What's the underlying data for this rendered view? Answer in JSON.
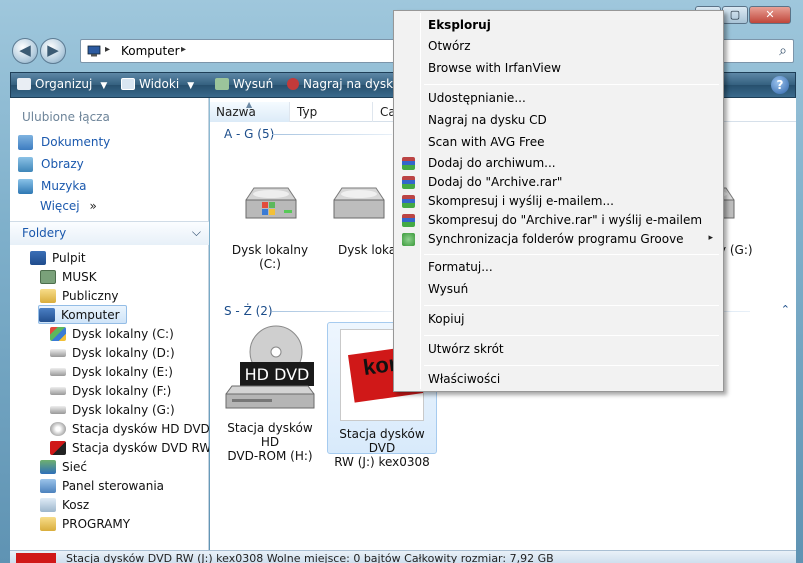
{
  "window": {
    "buttons": {
      "minimize": "",
      "maximize": "▢",
      "close": "✕"
    }
  },
  "address_bar": {
    "crumb": "Komputer",
    "sep1": "▸",
    "sep2": "▸"
  },
  "toolbar": {
    "organize": "Organizuj",
    "views": "Widoki",
    "eject": "Wysuń",
    "burn": "Nagraj na dysku",
    "help": "?"
  },
  "sidebar": {
    "favorites_title": "Ulubione łącza",
    "favorites": [
      {
        "label": "Dokumenty"
      },
      {
        "label": "Obrazy"
      },
      {
        "label": "Muzyka"
      }
    ],
    "more": "Więcej",
    "more_arrows": "»",
    "folders_title": "Foldery",
    "tree": [
      {
        "label": "Pulpit"
      },
      {
        "label": "MUSK"
      },
      {
        "label": "Publiczny"
      },
      {
        "label": "Komputer"
      },
      {
        "label": "Dysk lokalny (C:)"
      },
      {
        "label": "Dysk lokalny (D:)"
      },
      {
        "label": "Dysk lokalny (E:)"
      },
      {
        "label": "Dysk lokalny (F:)"
      },
      {
        "label": "Dysk lokalny (G:)"
      },
      {
        "label": "Stacja dysków HD DVD-R("
      },
      {
        "label": "Stacja dysków DVD RW (J:"
      },
      {
        "label": "Sieć"
      },
      {
        "label": "Panel sterowania"
      },
      {
        "label": "Kosz"
      },
      {
        "label": "PROGRAMY"
      }
    ]
  },
  "columns": {
    "name": "Nazwa",
    "type": "Typ",
    "total": "Cał"
  },
  "groups": {
    "a_g": "A - G (5)",
    "s_z": "S - Ż (2)"
  },
  "drives": {
    "c": "Dysk lokalny (C:)",
    "d": "Dysk lokal",
    "g": "lny (G:)",
    "hd_line1": "Stacja dysków HD",
    "hd_line2": "DVD-ROM (H:)",
    "dvd_line1": "Stacja dysków DVD",
    "dvd_line2": "RW (J:) kex0308",
    "hd_badge": "HD DVD",
    "dvd_badge": "kom"
  },
  "context_menu": {
    "items": [
      {
        "label": "Eksploruj"
      },
      {
        "label": "Otwórz"
      },
      {
        "label": "Browse with IrfanView"
      },
      {
        "label": "Udostępnianie..."
      },
      {
        "label": "Nagraj na dysku CD"
      },
      {
        "label": "Scan with AVG Free"
      },
      {
        "label": "Dodaj do archiwum..."
      },
      {
        "label": "Dodaj do \"Archive.rar\""
      },
      {
        "label": "Skompresuj i wyślij e-mailem..."
      },
      {
        "label": "Skompresuj do \"Archive.rar\" i wyślij e-mailem"
      },
      {
        "label": "Synchronizacja folderów programu Groove"
      },
      {
        "label": "Formatuj..."
      },
      {
        "label": "Wysuń"
      },
      {
        "label": "Kopiuj"
      },
      {
        "label": "Utwórz skrót"
      },
      {
        "label": "Właściwości"
      }
    ],
    "submenu_arrow": "▸"
  },
  "statusbar": {
    "text": "Stacja dysków DVD RW (J:) kex0308   Wolne miejsce: 0 bajtów        Całkowity rozmiar: 7,92 GB"
  },
  "colors": {
    "link_blue": "#1a58ad",
    "toolbar_bg": "#34607f",
    "menu_bg": "#f2f2f2",
    "selection": "#cfe4f8"
  }
}
